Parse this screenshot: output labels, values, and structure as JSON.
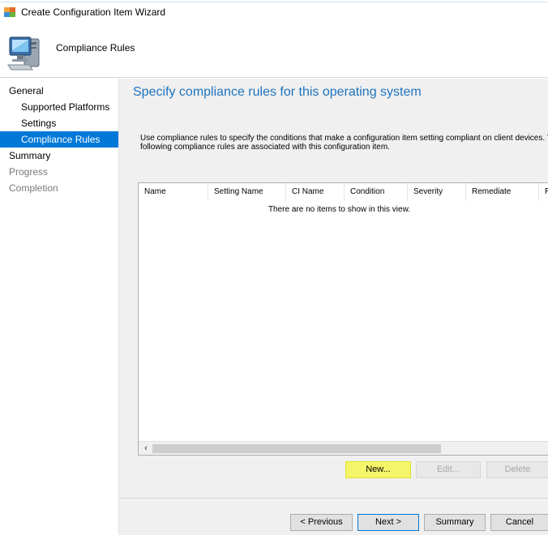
{
  "window": {
    "title": "Create Configuration Item Wizard"
  },
  "header": {
    "title": "Compliance Rules"
  },
  "sidebar": {
    "items": [
      {
        "label": "General",
        "level": 0,
        "state": "normal"
      },
      {
        "label": "Supported Platforms",
        "level": 1,
        "state": "normal"
      },
      {
        "label": "Settings",
        "level": 1,
        "state": "normal"
      },
      {
        "label": "Compliance Rules",
        "level": 1,
        "state": "active"
      },
      {
        "label": "Summary",
        "level": 0,
        "state": "normal"
      },
      {
        "label": "Progress",
        "level": 0,
        "state": "disabled"
      },
      {
        "label": "Completion",
        "level": 0,
        "state": "disabled"
      }
    ]
  },
  "main": {
    "heading": "Specify compliance rules for this operating system",
    "description_line1": "Use compliance rules to specify the conditions that make a configuration item setting compliant on client devices. The",
    "description_line2": "following compliance rules are associated with this configuration item."
  },
  "table": {
    "columns": [
      "Name",
      "Setting Name",
      "CI Name",
      "Condition",
      "Severity",
      "Remediate",
      "R"
    ],
    "empty_message": "There are no items to show in this view."
  },
  "list_buttons": {
    "new": "New...",
    "edit": "Edit...",
    "delete": "Delete"
  },
  "footer_buttons": {
    "previous": "< Previous",
    "next": "Next >",
    "summary": "Summary",
    "cancel": "Cancel"
  },
  "colors": {
    "accent": "#0078d7",
    "heading": "#1e73be",
    "highlight": "#f5f56a"
  }
}
